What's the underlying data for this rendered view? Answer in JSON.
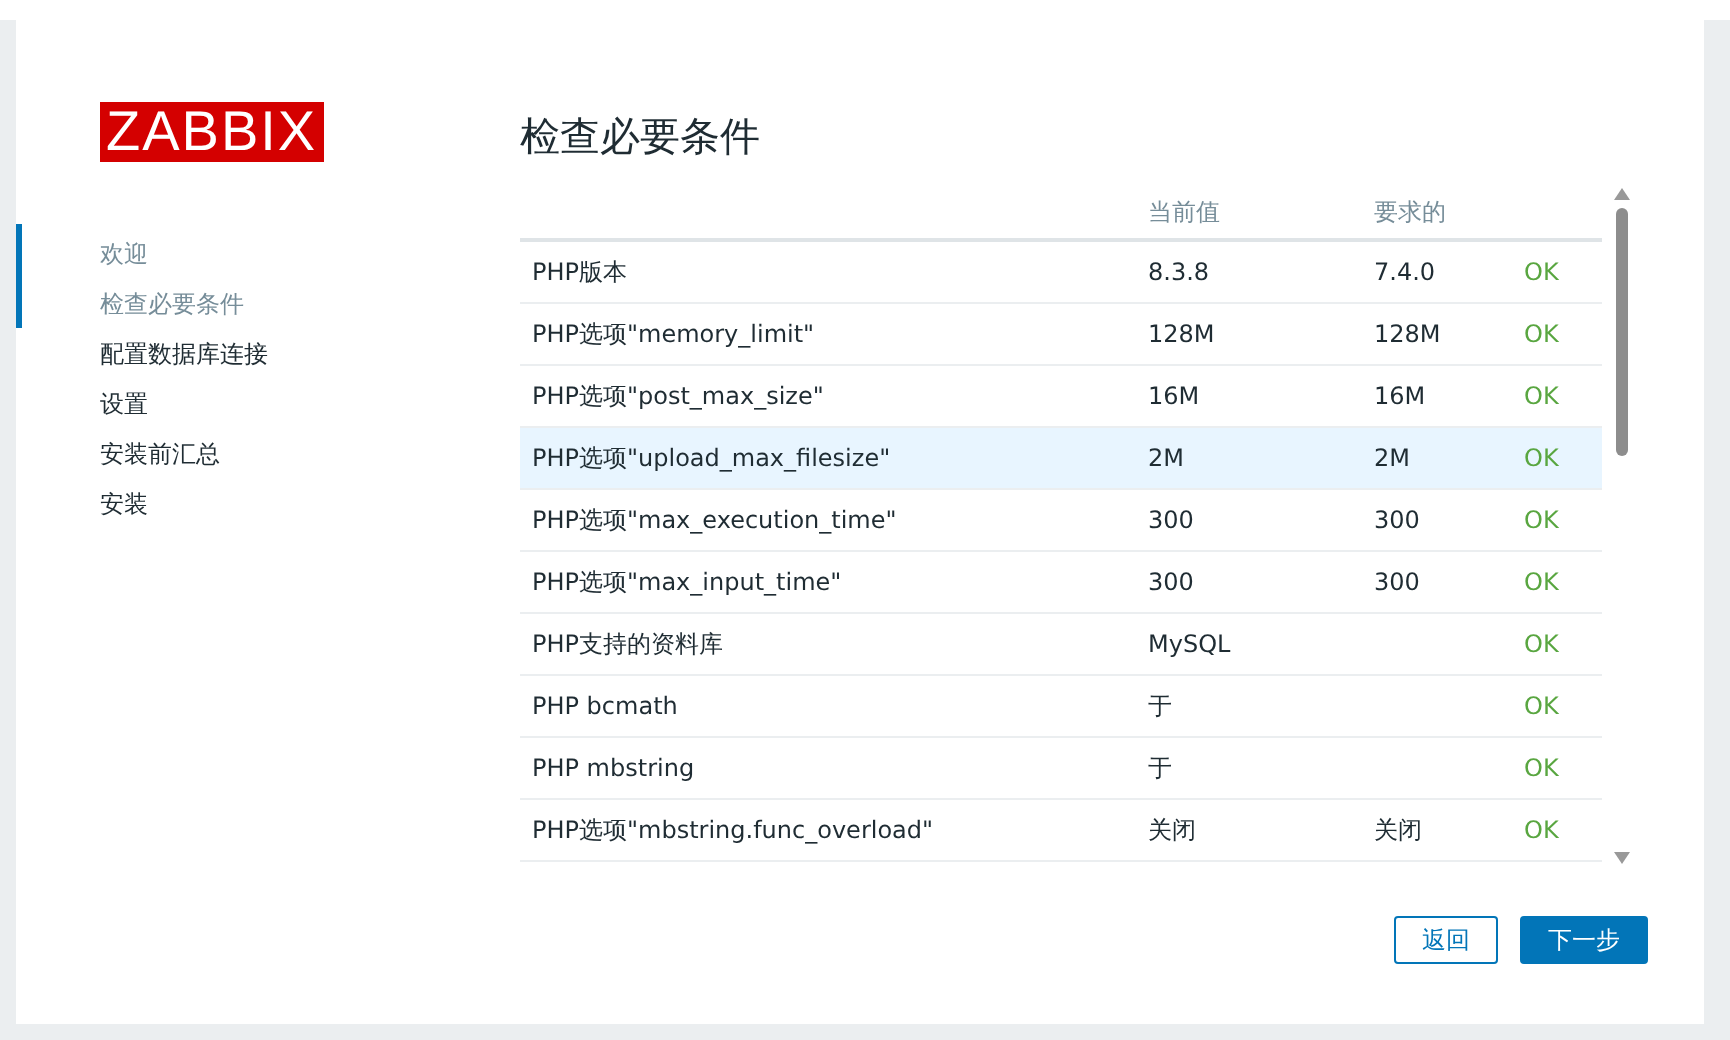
{
  "logo": "ZABBIX",
  "steps": [
    {
      "label": "欢迎",
      "visited": true
    },
    {
      "label": "检查必要条件",
      "visited": true
    },
    {
      "label": "配置数据库连接",
      "visited": false
    },
    {
      "label": "设置",
      "visited": false
    },
    {
      "label": "安装前汇总",
      "visited": false
    },
    {
      "label": "安装",
      "visited": false
    }
  ],
  "title": "检查必要条件",
  "table": {
    "columns": [
      "当前值",
      "要求的"
    ],
    "rows": [
      {
        "name": "PHP版本",
        "current": "8.3.8",
        "required": "7.4.0",
        "result": "OK",
        "highlighted": false
      },
      {
        "name": "PHP选项\"memory_limit\"",
        "current": "128M",
        "required": "128M",
        "result": "OK",
        "highlighted": false
      },
      {
        "name": "PHP选项\"post_max_size\"",
        "current": "16M",
        "required": "16M",
        "result": "OK",
        "highlighted": false
      },
      {
        "name": "PHP选项\"upload_max_filesize\"",
        "current": "2M",
        "required": "2M",
        "result": "OK",
        "highlighted": true
      },
      {
        "name": "PHP选项\"max_execution_time\"",
        "current": "300",
        "required": "300",
        "result": "OK",
        "highlighted": false
      },
      {
        "name": "PHP选项\"max_input_time\"",
        "current": "300",
        "required": "300",
        "result": "OK",
        "highlighted": false
      },
      {
        "name": "PHP支持的资料库",
        "current": "MySQL",
        "result": "OK",
        "highlighted": false
      },
      {
        "name": "PHP bcmath",
        "current": "于",
        "result": "OK",
        "highlighted": false
      },
      {
        "name": "PHP mbstring",
        "current": "于",
        "result": "OK",
        "highlighted": false
      },
      {
        "name": "PHP选项\"mbstring.func_overload\"",
        "current": "关闭",
        "required": "关闭",
        "result": "OK",
        "highlighted": false
      }
    ]
  },
  "buttons": [
    {
      "label": "返回",
      "kind": "secondary"
    },
    {
      "label": "下一步",
      "kind": "primary"
    }
  ]
}
